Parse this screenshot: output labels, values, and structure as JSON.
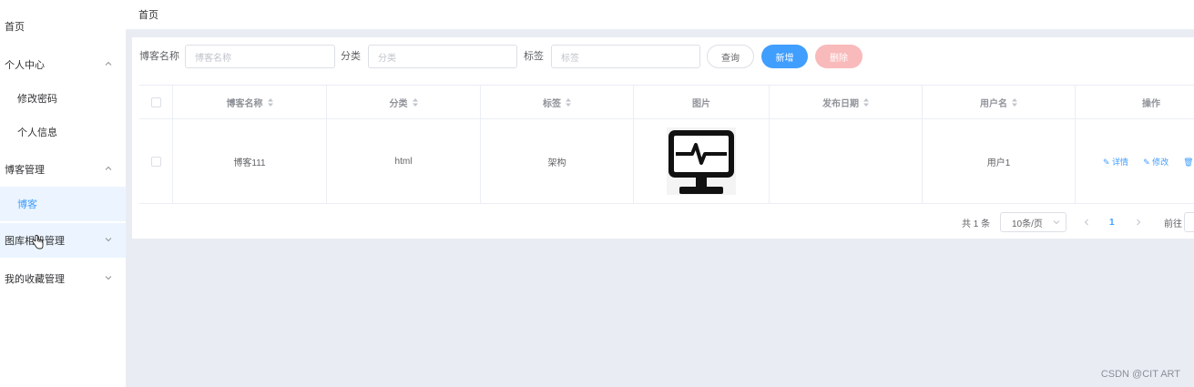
{
  "sidebar": {
    "items": [
      {
        "label": "首页"
      },
      {
        "label": "个人中心"
      },
      {
        "label": "修改密码"
      },
      {
        "label": "个人信息"
      },
      {
        "label": "博客管理"
      },
      {
        "label": "博客"
      },
      {
        "label": "图库相册管理"
      },
      {
        "label": "我的收藏管理"
      }
    ]
  },
  "breadcrumb": "首页",
  "search": {
    "name_label": "博客名称",
    "name_placeholder": "博客名称",
    "category_label": "分类",
    "category_placeholder": "分类",
    "tag_label": "标签",
    "tag_placeholder": "标签",
    "query_button": "查询",
    "add_button": "新增",
    "delete_button": "删除"
  },
  "table": {
    "headers": [
      "博客名称",
      "分类",
      "标签",
      "图片",
      "发布日期",
      "用户名",
      "操作"
    ],
    "rows": [
      {
        "name": "博客111",
        "category": "html",
        "tag": "架构",
        "image_icon": "monitor-pulse-icon",
        "date": "",
        "user": "用户1"
      }
    ],
    "actions": [
      "详情",
      "修改",
      "删"
    ]
  },
  "pagination": {
    "total": "共 1 条",
    "page_size": "10条/页",
    "current_page": "1",
    "goto_label": "前往"
  },
  "watermark": "CSDN @CIT ART",
  "colors": {
    "accent": "#409eff",
    "danger": "#f9babb",
    "background": "#e9edf3"
  }
}
